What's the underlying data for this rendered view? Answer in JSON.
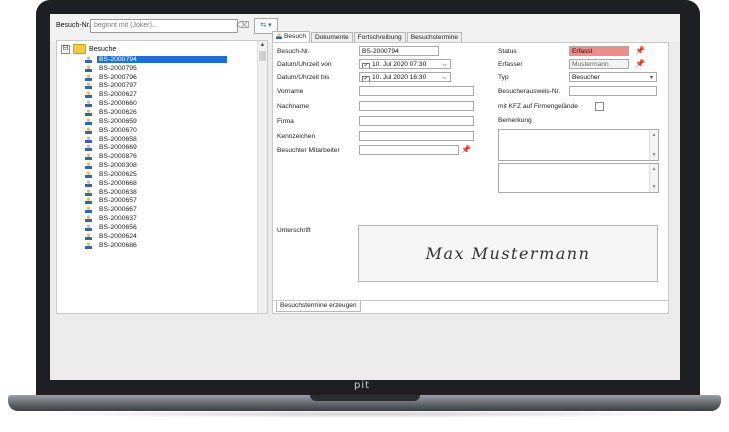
{
  "brand": {
    "bezel_logo": "pit"
  },
  "search": {
    "label": "Besuch-Nr.",
    "placeholder": "beginnt mit (Joker)...",
    "clear_icon": "eraser-icon",
    "options_icon": "filter-options-icon"
  },
  "tree": {
    "root_label": "Besuche",
    "expander": "⊟",
    "items": [
      {
        "label": "BS-2000794",
        "selected": true
      },
      {
        "label": "BS-2000795"
      },
      {
        "label": "BS-2000796"
      },
      {
        "label": "BS-2000797"
      },
      {
        "label": "BS-2000627"
      },
      {
        "label": "BS-2000660"
      },
      {
        "label": "BS-2000626"
      },
      {
        "label": "BS-2000659"
      },
      {
        "label": "BS-2000670"
      },
      {
        "label": "BS-2000658"
      },
      {
        "label": "BS-2000669"
      },
      {
        "label": "BS-2000876"
      },
      {
        "label": "BS-2000308"
      },
      {
        "label": "BS-2000625"
      },
      {
        "label": "BS-2000668"
      },
      {
        "label": "BS-2000638"
      },
      {
        "label": "BS-2000657"
      },
      {
        "label": "BS-2000667"
      },
      {
        "label": "BS-2000637"
      },
      {
        "label": "BS-2000656"
      },
      {
        "label": "BS-2000624"
      },
      {
        "label": "BS-2000686"
      }
    ]
  },
  "tabs": [
    "Besuch",
    "Dokumente",
    "Fortschreibung",
    "Besuchstermine"
  ],
  "form": {
    "besuch_nr_label": "Besuch-Nr.",
    "besuch_nr_value": "BS-2000794",
    "von_label": "Datum/Uhrzeit von",
    "von_value": "10. Jul  2020 07:30",
    "bis_label": "Datum/Uhrzeit bis",
    "bis_value": "10. Jul  2020 16:30",
    "vorname_label": "Vorname",
    "nachname_label": "Nachname",
    "firma_label": "Firma",
    "kennzeichen_label": "Kennzeichen",
    "mitarbeiter_label": "Besuchter Mitarbeiter",
    "status_label": "Status",
    "status_value": "Erfasst",
    "erfasser_label": "Erfasser",
    "erfasser_value": "Mustermann",
    "typ_label": "Typ",
    "typ_value": "Besucher",
    "ausweis_label": "Besucherausweis-Nr.",
    "kfz_label": "mit KFZ auf Firmengelände",
    "bemerkung_label": "Bemerkung",
    "unterschrift_label": "Unterschrift",
    "signature_text": "Max Mustermann",
    "footer_button": "Besuchstermine erzeugen"
  },
  "colors": {
    "selection": "#1f6fd0",
    "status_bg": "#f28b8b",
    "pin": "#d8202a"
  }
}
